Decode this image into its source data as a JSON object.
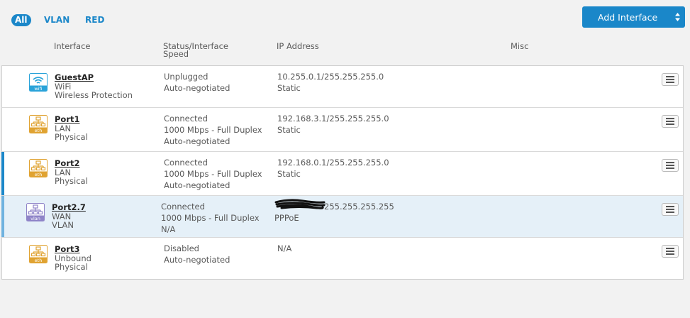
{
  "filters": {
    "all": "All",
    "vlan": "VLAN",
    "red": "RED"
  },
  "toolbar": {
    "add_label": "Add Interface"
  },
  "columns": {
    "interface": "Interface",
    "status_line1": "Status/Interface",
    "status_line2": "Speed",
    "ip": "IP Address",
    "misc": "Misc"
  },
  "colors": {
    "accent": "#1b87c9",
    "eth": "#e0a332",
    "wifi": "#2aa3d9",
    "vlan": "#8f84c8",
    "selected_row": "#e5f0f8"
  },
  "rows": [
    {
      "icon": "wifi-icon",
      "badge": "wifi",
      "name": "GuestAP",
      "type": "WiFi",
      "kind": "Wireless Protection",
      "status": [
        "Unplugged",
        "Auto-negotiated"
      ],
      "ip": [
        "10.255.0.1/255.255.255.0",
        "Static"
      ]
    },
    {
      "icon": "ethernet-icon",
      "badge": "eth",
      "name": "Port1",
      "type": "LAN",
      "kind": "Physical",
      "status": [
        "Connected",
        "1000 Mbps - Full Duplex",
        "Auto-negotiated"
      ],
      "ip": [
        "192.168.3.1/255.255.255.0",
        "Static"
      ]
    },
    {
      "icon": "ethernet-icon",
      "badge": "eth",
      "name": "Port2",
      "type": "LAN",
      "kind": "Physical",
      "status": [
        "Connected",
        "1000 Mbps - Full Duplex",
        "Auto-negotiated"
      ],
      "ip": [
        "192.168.0.1/255.255.255.0",
        "Static"
      ]
    },
    {
      "icon": "vlan-icon",
      "badge": "vlan",
      "name": "Port2.7",
      "type": "WAN",
      "kind": "VLAN",
      "status": [
        "Connected",
        "1000 Mbps - Full Duplex",
        "N/A"
      ],
      "ip": [
        "255.255.255.255",
        "PPPoE"
      ]
    },
    {
      "icon": "ethernet-icon",
      "badge": "eth",
      "name": "Port3",
      "type": "Unbound",
      "kind": "Physical",
      "status": [
        "Disabled",
        "Auto-negotiated"
      ],
      "ip": [
        "N/A"
      ]
    }
  ]
}
